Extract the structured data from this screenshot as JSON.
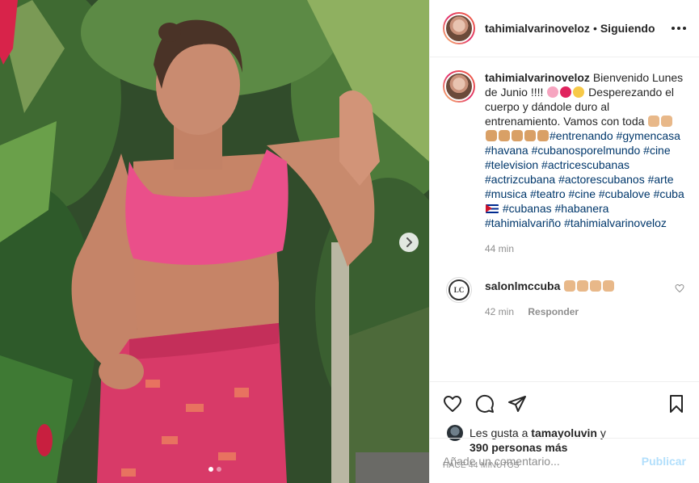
{
  "post": {
    "username": "tahimialvarinoveloz",
    "separator": "•",
    "follow_status": "Siguiendo",
    "caption": {
      "username": "tahimialvarinoveloz",
      "text_1": "Bienvenido Lunes de Junio !!!! ",
      "text_2": "Desperezando el cuerpo y dándole duro al entrenamiento. Vamos con toda ",
      "hashtags": [
        "#entrenando",
        "#gymencasa",
        "#havana",
        "#cubanosporelmundo",
        "#cine",
        "#television",
        "#actricescubanas",
        "#actrizcubana",
        "#actorescubanos",
        "#arte",
        "#musica",
        "#teatro",
        "#cine",
        "#cubalove",
        "#cuba",
        "#cubanas",
        "#habanera",
        "#tahimialvariño",
        "#tahimialvarinoveloz"
      ]
    },
    "caption_time": "44 min",
    "comment": {
      "username": "salonlmccuba",
      "logo_text": "LC",
      "time": "42 min",
      "reply_label": "Responder"
    },
    "likes": {
      "prefix": "Les gusta a ",
      "first_user": "tamayoluvin",
      "connector": " y",
      "others": "390 personas más"
    },
    "timestamp": "HACE 44 MINUTOS",
    "add_comment_placeholder": "Añade un comentario...",
    "publish_label": "Publicar",
    "carousel": {
      "slides": 2,
      "active": 1
    }
  },
  "icons": {
    "more": "more-options-icon",
    "like": "heart-icon",
    "comment": "comment-icon",
    "share": "paper-plane-icon",
    "save": "bookmark-icon",
    "next": "chevron-right-icon"
  },
  "colors": {
    "link": "#00376b",
    "muted": "#8e8e8e",
    "publish_disabled": "#b2dffc",
    "border": "#efefef"
  }
}
